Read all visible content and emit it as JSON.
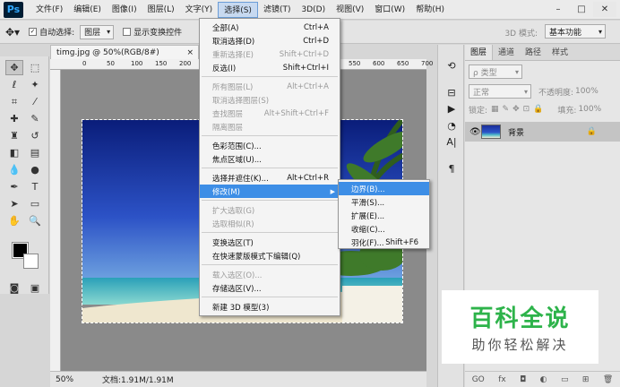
{
  "app": {
    "logo": "Ps"
  },
  "menubar": {
    "items": [
      "文件(F)",
      "编辑(E)",
      "图像(I)",
      "图层(L)",
      "文字(Y)",
      "选择(S)",
      "滤镜(T)",
      "3D(D)",
      "视图(V)",
      "窗口(W)",
      "帮助(H)"
    ],
    "active_index": 5
  },
  "window_controls": {
    "minimize": "–",
    "maximize": "□",
    "close": "✕"
  },
  "options_bar": {
    "auto_select_label": "自动选择:",
    "auto_select_checked": "✓",
    "auto_select_value": "图层",
    "show_transform_label": "显示变换控件",
    "mode_3d_label": "3D 模式:",
    "workspace": "基本功能"
  },
  "document": {
    "tab_title": "timg.jpg @ 50%(RGB/8#)",
    "tab_close": "×",
    "zoom": "50%",
    "doc_info": "文档:1.91M/1.91M",
    "ruler_marks": [
      "0",
      "50",
      "100",
      "150",
      "200",
      "250",
      "300",
      "350",
      "400",
      "450",
      "500",
      "550",
      "600",
      "650",
      "700"
    ]
  },
  "select_menu": {
    "items": [
      {
        "label": "全部(A)",
        "shortcut": "Ctrl+A",
        "disabled": false
      },
      {
        "label": "取消选择(D)",
        "shortcut": "Ctrl+D",
        "disabled": false
      },
      {
        "label": "重新选择(E)",
        "shortcut": "Shift+Ctrl+D",
        "disabled": true
      },
      {
        "label": "反选(I)",
        "shortcut": "Shift+Ctrl+I",
        "disabled": false
      },
      {
        "label": "所有图层(L)",
        "shortcut": "Alt+Ctrl+A",
        "disabled": true
      },
      {
        "label": "取消选择图层(S)",
        "shortcut": "",
        "disabled": true
      },
      {
        "label": "查找图层",
        "shortcut": "Alt+Shift+Ctrl+F",
        "disabled": true
      },
      {
        "label": "隔离图层",
        "shortcut": "",
        "disabled": true
      },
      {
        "label": "色彩范围(C)...",
        "shortcut": "",
        "disabled": false
      },
      {
        "label": "焦点区域(U)...",
        "shortcut": "",
        "disabled": false
      },
      {
        "label": "选择并遮住(K)...",
        "shortcut": "Alt+Ctrl+R",
        "disabled": false
      },
      {
        "label": "修改(M)",
        "shortcut": "",
        "disabled": false,
        "highlighted": true,
        "has_submenu": true
      },
      {
        "label": "扩大选取(G)",
        "shortcut": "",
        "disabled": true
      },
      {
        "label": "选取相似(R)",
        "shortcut": "",
        "disabled": true
      },
      {
        "label": "变换选区(T)",
        "shortcut": "",
        "disabled": false
      },
      {
        "label": "在快速蒙版模式下编辑(Q)",
        "shortcut": "",
        "disabled": false
      },
      {
        "label": "载入选区(O)...",
        "shortcut": "",
        "disabled": true
      },
      {
        "label": "存储选区(V)...",
        "shortcut": "",
        "disabled": false
      },
      {
        "label": "新建 3D 模型(3)",
        "shortcut": "",
        "disabled": false
      }
    ],
    "submenu_arrow": "▶"
  },
  "modify_submenu": {
    "items": [
      {
        "label": "边界(B)...",
        "shortcut": "",
        "highlighted": true
      },
      {
        "label": "平滑(S)...",
        "shortcut": ""
      },
      {
        "label": "扩展(E)...",
        "shortcut": ""
      },
      {
        "label": "收缩(C)...",
        "shortcut": ""
      },
      {
        "label": "羽化(F)...",
        "shortcut": "Shift+F6"
      }
    ]
  },
  "layers_panel": {
    "tabs": [
      "图层",
      "通道",
      "路径",
      "样式"
    ],
    "active_tab": 0,
    "filter_label": "ρ 类型",
    "blend_mode": "正常",
    "opacity_label": "不透明度:",
    "opacity_value": "100%",
    "lock_label": "锁定:",
    "fill_label": "填充:",
    "fill_value": "100%",
    "layer_name": "背景",
    "bottom_icons": [
      "GO",
      "fx",
      "◘",
      "◐",
      "▭",
      "⊞",
      "🗑"
    ]
  },
  "watermark": {
    "title": "百科全说",
    "subtitle": "助你轻松解决"
  }
}
